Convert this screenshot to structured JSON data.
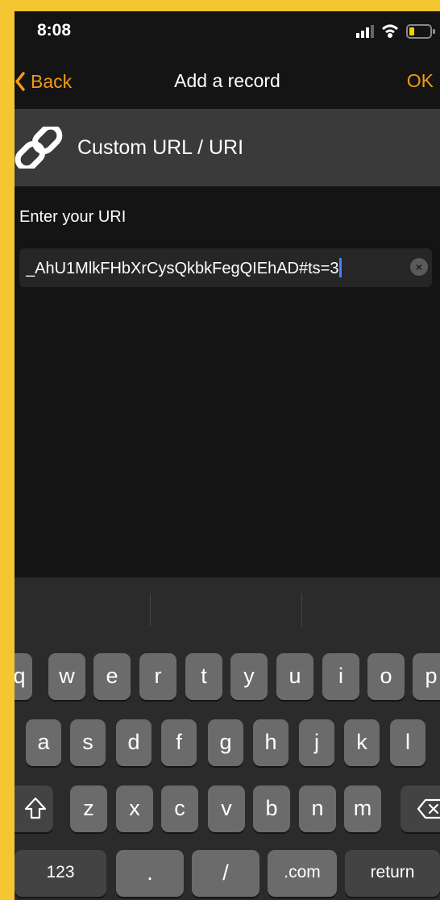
{
  "status_bar": {
    "time": "8:08"
  },
  "nav": {
    "back_label": "Back",
    "title": "Add a record",
    "ok_label": "OK"
  },
  "record_type": {
    "label": "Custom URL / URI",
    "icon": "link-icon"
  },
  "uri_field": {
    "prompt": "Enter your URI",
    "value": "_AhU1MlkFHbXrCysQkbkFegQIEhAD#ts=3"
  },
  "keyboard": {
    "row1": [
      "q",
      "w",
      "e",
      "r",
      "t",
      "y",
      "u",
      "i",
      "o",
      "p"
    ],
    "row2": [
      "a",
      "s",
      "d",
      "f",
      "g",
      "h",
      "j",
      "k",
      "l"
    ],
    "row3": [
      "z",
      "x",
      "c",
      "v",
      "b",
      "n",
      "m"
    ],
    "numbers_label": "123",
    "period_label": ".",
    "slash_label": "/",
    "dotcom_label": ".com",
    "return_label": "return"
  },
  "colors": {
    "accent": "#f19a14",
    "background": "#141414",
    "frame": "#f5c631"
  }
}
